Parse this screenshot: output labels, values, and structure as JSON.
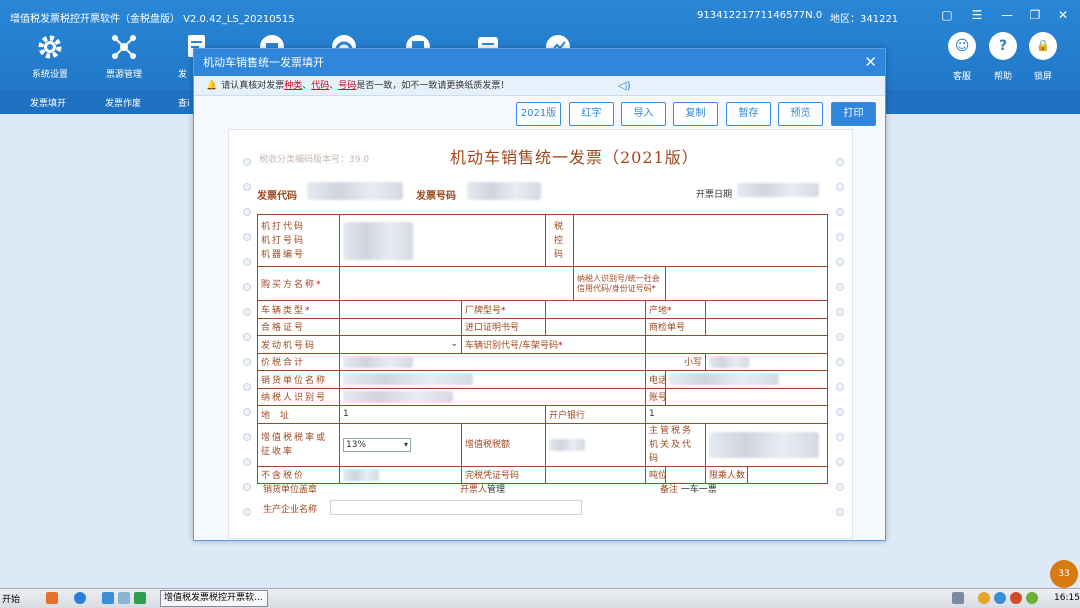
{
  "app": {
    "title": "增值税发票税控开票软件（金税盘版） V2.0.42_LS_20210515",
    "taxid": "91341221771146577N.0",
    "region": "地区：341221",
    "window_controls": [
      "▢",
      "☰",
      "—",
      "❐",
      "✕"
    ]
  },
  "toolbar": [
    {
      "label": "系统设置",
      "icon": "gear-icon"
    },
    {
      "label": "票源管理",
      "icon": "network-icon"
    },
    {
      "label": "发",
      "icon": "document-icon"
    },
    {
      "label": "",
      "icon": "print-icon"
    },
    {
      "label": "",
      "icon": "gauge-icon"
    },
    {
      "label": "",
      "icon": "monitor-icon"
    },
    {
      "label": "",
      "icon": "report-icon"
    },
    {
      "label": "",
      "icon": "chart-icon"
    }
  ],
  "right_buttons": [
    {
      "label": "客服",
      "glyph": "☺"
    },
    {
      "label": "帮助",
      "glyph": "?"
    },
    {
      "label": "锁屏",
      "glyph": "🔒"
    }
  ],
  "nav": [
    "发票填开",
    "发票作废",
    "查i"
  ],
  "dialog": {
    "title": "机动车销售统一发票填开",
    "close": "✕",
    "notice_pre": "请认真核对发票",
    "notice_k1": "种类",
    "notice_sep1": "、",
    "notice_k2": "代码",
    "notice_sep2": "、",
    "notice_k3": "号码",
    "notice_post": "是否一致，如不一致请更换纸质发票！",
    "buttons": [
      "2021版",
      "红字",
      "导入",
      "复制",
      "暂存",
      "预览",
      "打印"
    ]
  },
  "invoice": {
    "version": "税收分类编码版本号：39.0",
    "heading": "机动车销售统一发票（2021版）",
    "code_label": "发票代码",
    "number_label": "发票号码",
    "date_label": "开票日期",
    "rows": {
      "machine_code": "机打代码",
      "machine_no": "机打号码",
      "device_no": "机器编号",
      "tax_control": "税控码",
      "buyer": "购买方名称",
      "buyer_id": "纳税人识别号/统一社会信用代码/身份证号码",
      "vehicle_type": "车辆类型",
      "brand_model": "厂牌型号",
      "origin": "产地",
      "cert_no": "合格证号",
      "import_cert": "进口证明书号",
      "inspection_no": "商检单号",
      "engine_no": "发动机号码",
      "vin": "车辆识别代号/车架号码",
      "total_tax": "价税合计",
      "lowercase": "小写",
      "seller_name": "销货单位名称",
      "phone": "电话",
      "seller_id": "纳税人识别号",
      "account": "账号",
      "address": "地址",
      "address_val": "1",
      "bank": "开户银行",
      "bank_val": "1",
      "vat_rate": "增值税税率或征收率",
      "vat_rate_val": "13%",
      "vat_amount": "增值税税额",
      "tax_authority": "主管税务机关及代码",
      "excl_price": "不含税价",
      "duty_cert": "完税凭证号码",
      "tonnage": "吨位",
      "capacity": "限乘人数"
    },
    "footer": {
      "seal": "销货单位盖章",
      "drawer": "开票人",
      "drawer_val": "管理",
      "remark": "备注",
      "remark_val": "一车一票",
      "manufacturer": "生产企业名称"
    }
  },
  "taskbar": {
    "start": "开始",
    "task": "增值税发票税控开票软...",
    "clock": "16:15",
    "badge": "33"
  },
  "colors": {
    "accent": "#2f86da",
    "invoice_line": "#a0471e",
    "required": "#d0021b"
  }
}
